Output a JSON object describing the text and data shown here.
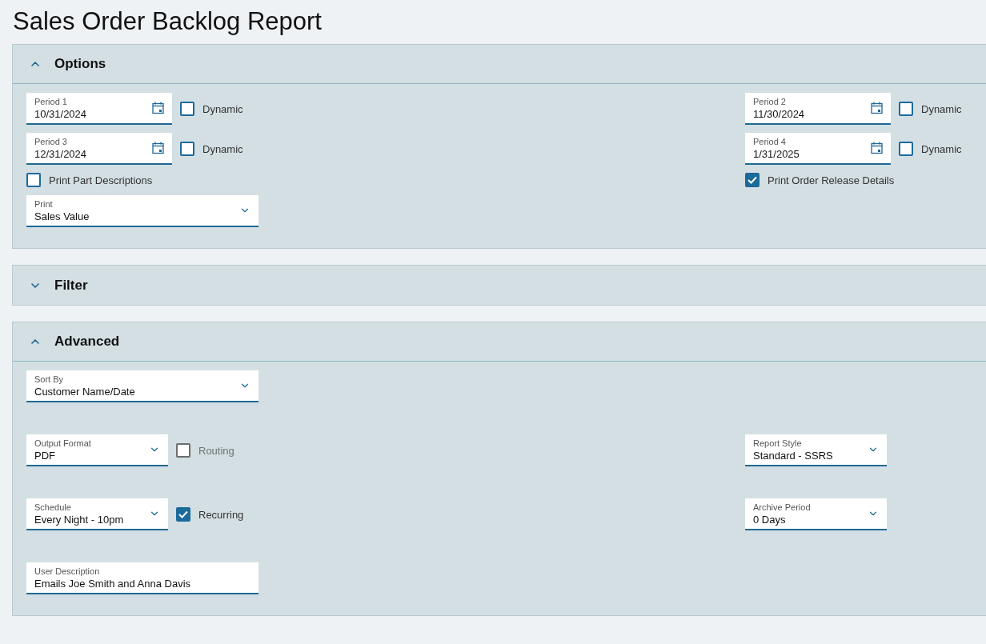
{
  "title": "Sales Order Backlog Report",
  "sections": [
    {
      "title": "Options",
      "expanded": true,
      "rows": [
        {
          "left": [
            {
              "kind": "date",
              "label": "Period 1",
              "value": "10/31/2024"
            },
            {
              "kind": "checkbox",
              "label": "Dynamic",
              "checked": false,
              "disabled": false
            }
          ],
          "right": [
            {
              "kind": "date",
              "label": "Period 2",
              "value": "11/30/2024"
            },
            {
              "kind": "checkbox",
              "label": "Dynamic",
              "checked": false,
              "disabled": false
            }
          ]
        },
        {
          "left": [
            {
              "kind": "date",
              "label": "Period 3",
              "value": "12/31/2024"
            },
            {
              "kind": "checkbox",
              "label": "Dynamic",
              "checked": false,
              "disabled": false
            }
          ],
          "right": [
            {
              "kind": "date",
              "label": "Period 4",
              "value": "1/31/2025"
            },
            {
              "kind": "checkbox",
              "label": "Dynamic",
              "checked": false,
              "disabled": false
            }
          ]
        },
        {
          "left": [
            {
              "kind": "checkbox",
              "label": "Print Part Descriptions",
              "checked": false,
              "disabled": false
            }
          ],
          "right": [
            {
              "kind": "checkbox",
              "label": "Print Order Release Details",
              "checked": true,
              "disabled": false
            }
          ]
        },
        {
          "left": [
            {
              "kind": "select",
              "label": "Print",
              "value": "Sales Value"
            }
          ],
          "right": []
        }
      ]
    },
    {
      "title": "Filter",
      "expanded": false
    },
    {
      "title": "Advanced",
      "expanded": true,
      "rows": [
        {
          "left": [
            {
              "kind": "select",
              "label": "Sort By",
              "value": "Customer Name/Date"
            }
          ],
          "right": []
        },
        {
          "left": [
            {
              "kind": "select",
              "label": "Output Format",
              "value": "PDF"
            },
            {
              "kind": "checkbox",
              "label": "Routing",
              "checked": false,
              "disabled": true
            }
          ],
          "right": [
            {
              "kind": "select",
              "label": "Report Style",
              "value": "Standard - SSRS"
            }
          ]
        },
        {
          "left": [
            {
              "kind": "select",
              "label": "Schedule",
              "value": "Every Night - 10pm"
            },
            {
              "kind": "checkbox",
              "label": "Recurring",
              "checked": true,
              "disabled": false
            }
          ],
          "right": [
            {
              "kind": "select",
              "label": "Archive Period",
              "value": "0 Days"
            }
          ]
        },
        {
          "left": [
            {
              "kind": "text",
              "label": "User Description",
              "value": "Emails Joe Smith and Anna Davis"
            }
          ],
          "right": []
        }
      ]
    }
  ]
}
